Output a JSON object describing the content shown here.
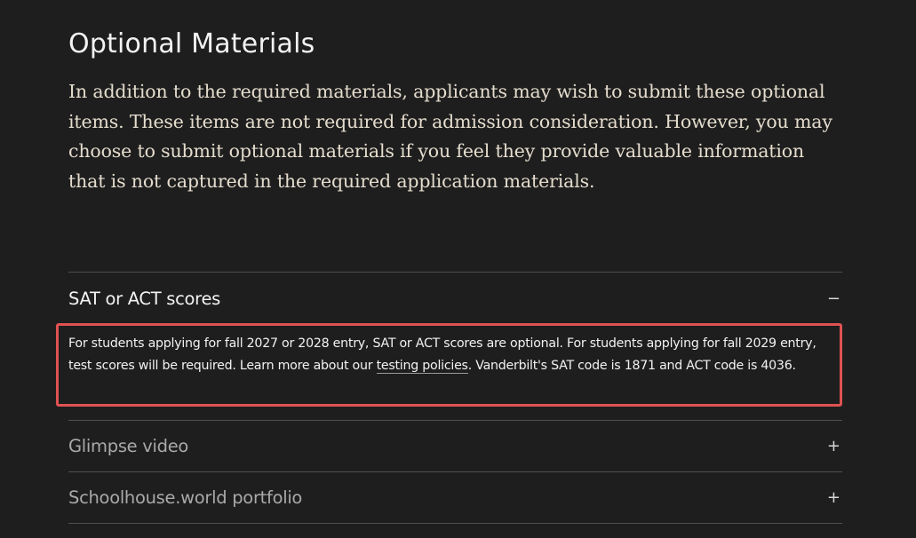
{
  "title": "Optional Materials",
  "intro": "In addition to the required materials, applicants may wish to submit these optional items. These items are not required for admission consideration. However, you may choose to submit optional materials if you feel they provide valuable information that is not captured in the required application materials.",
  "accordion": {
    "items": [
      {
        "title": "SAT or ACT scores",
        "toggle": "−",
        "expanded": true,
        "body_before": "For students applying for fall 2027 or 2028 entry, SAT or ACT scores are optional. For students applying for fall 2029 entry, test scores will be required. Learn more about our ",
        "link_text": "testing policies",
        "body_after": ". Vanderbilt's SAT code is 1871 and ACT code is 4036."
      },
      {
        "title": "Glimpse video",
        "toggle": "+",
        "expanded": false
      },
      {
        "title": "Schoolhouse.world portfolio",
        "toggle": "+",
        "expanded": false
      }
    ]
  },
  "colors": {
    "background": "#1e1e1e",
    "intro_text": "#e4dccd",
    "highlight_border": "#e05252"
  }
}
